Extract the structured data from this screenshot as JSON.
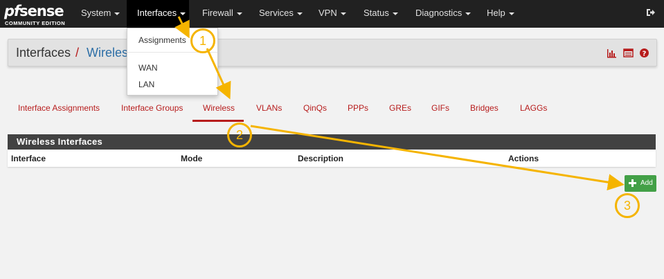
{
  "colors": {
    "navbar_bg": "#212121",
    "nav_active_bg": "#000000",
    "brand_red": "#b71c1c",
    "breadcrumb_blue": "#2c6ea6",
    "panel_header_bg": "#424242",
    "add_button_bg": "#43a047",
    "annotation_yellow": "#f5b400"
  },
  "brand": {
    "logo_text_pf": "pf",
    "logo_text_sense": "sense",
    "edition": "COMMUNITY EDITION"
  },
  "navbar": {
    "items": [
      {
        "label": "System"
      },
      {
        "label": "Interfaces"
      },
      {
        "label": "Firewall"
      },
      {
        "label": "Services"
      },
      {
        "label": "VPN"
      },
      {
        "label": "Status"
      },
      {
        "label": "Diagnostics"
      },
      {
        "label": "Help"
      }
    ],
    "signout_icon": "sign-out-icon"
  },
  "dropdown": {
    "items": [
      {
        "label": "Assignments"
      },
      {
        "label": "WAN"
      },
      {
        "label": "LAN"
      }
    ]
  },
  "breadcrumb": {
    "root": "Interfaces",
    "separator": "/",
    "current": "Wireless"
  },
  "header_icons": [
    "bar-chart-icon",
    "list-icon",
    "help-icon"
  ],
  "tabs": [
    {
      "label": "Interface Assignments"
    },
    {
      "label": "Interface Groups"
    },
    {
      "label": "Wireless",
      "active": true
    },
    {
      "label": "VLANs"
    },
    {
      "label": "QinQs"
    },
    {
      "label": "PPPs"
    },
    {
      "label": "GREs"
    },
    {
      "label": "GIFs"
    },
    {
      "label": "Bridges"
    },
    {
      "label": "LAGGs"
    }
  ],
  "panel": {
    "title": "Wireless Interfaces",
    "columns": [
      "Interface",
      "Mode",
      "Description",
      "Actions"
    ]
  },
  "add_button": {
    "label": "Add",
    "icon": "plus-icon"
  },
  "annotations": [
    "1",
    "2",
    "3"
  ]
}
